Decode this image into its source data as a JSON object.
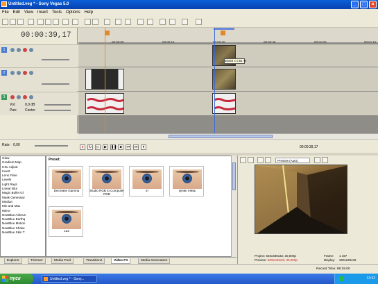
{
  "window": {
    "title": "Untitled.veg * - Sony Vegas 5.0",
    "controls": {
      "minimize": "_",
      "maximize": "□",
      "close": "×"
    }
  },
  "menu": [
    "File",
    "Edit",
    "View",
    "Insert",
    "Tools",
    "Options",
    "Help"
  ],
  "timecode": "00:00:39,17",
  "ruler": {
    "labels": [
      "00:00:00",
      "00:00:15",
      "00:00:30",
      "00:00:45",
      "00:01:00",
      "00:01:15"
    ]
  },
  "tracks": [
    {
      "number": "1"
    },
    {
      "number": "2"
    },
    {
      "number": "3",
      "vol_label": "Vol:",
      "vol_value": "0,0 dB",
      "pan_label": "Pan:",
      "pan_value": "Center"
    }
  ],
  "clip_tooltip": "50x50 x 0,51 %",
  "rate": {
    "label": "Rate:",
    "value": "0,00"
  },
  "transport": {
    "position": "00:00:39,17"
  },
  "fx_list": [
    "Glow",
    "Gradient Map",
    "HSL Adjust",
    "Invert",
    "Lens Flare",
    "Levels",
    "Light Rays",
    "Linear Blur",
    "Magic Bullet Gl",
    "Mask Generator",
    "Median",
    "Min and Max",
    "Mirror",
    "NewBlue Airbrus",
    "NewBlue Earthq",
    "NewBlue Motion",
    "NewBlue Shake",
    "NewBlue Skin T"
  ],
  "presets": {
    "header": "Preset:",
    "items": [
      "Decrease Gamma",
      "Studio RGB to Computer RGB",
      "хт",
      "купик тнявь",
      "123"
    ]
  },
  "tabs": [
    "Explorer",
    "Trimmer",
    "Media Pool",
    "Transitions",
    "Video FX",
    "Media Generators"
  ],
  "active_tab": "Video FX",
  "preview": {
    "mode": "Preview (Auto)",
    "project_label": "Project:",
    "project_value": "640x480x32; 30,000p",
    "preview_label": "Preview:",
    "preview_value": "320x240x32; 30,000p",
    "frame_label": "Frame:",
    "frame_value": "1 197",
    "display_label": "Display:",
    "display_value": "320x240x32"
  },
  "status": {
    "record_time": "Record Time: 88:15:00"
  },
  "taskbar": {
    "start": "пуск",
    "item": "Untitled.veg * - Sony...",
    "clock": "13:32"
  },
  "colors": {
    "titlebar": "#0a5fd8",
    "cursor": "#3a6ad8",
    "marker": "#e0892a",
    "audio": "#c8283a"
  }
}
